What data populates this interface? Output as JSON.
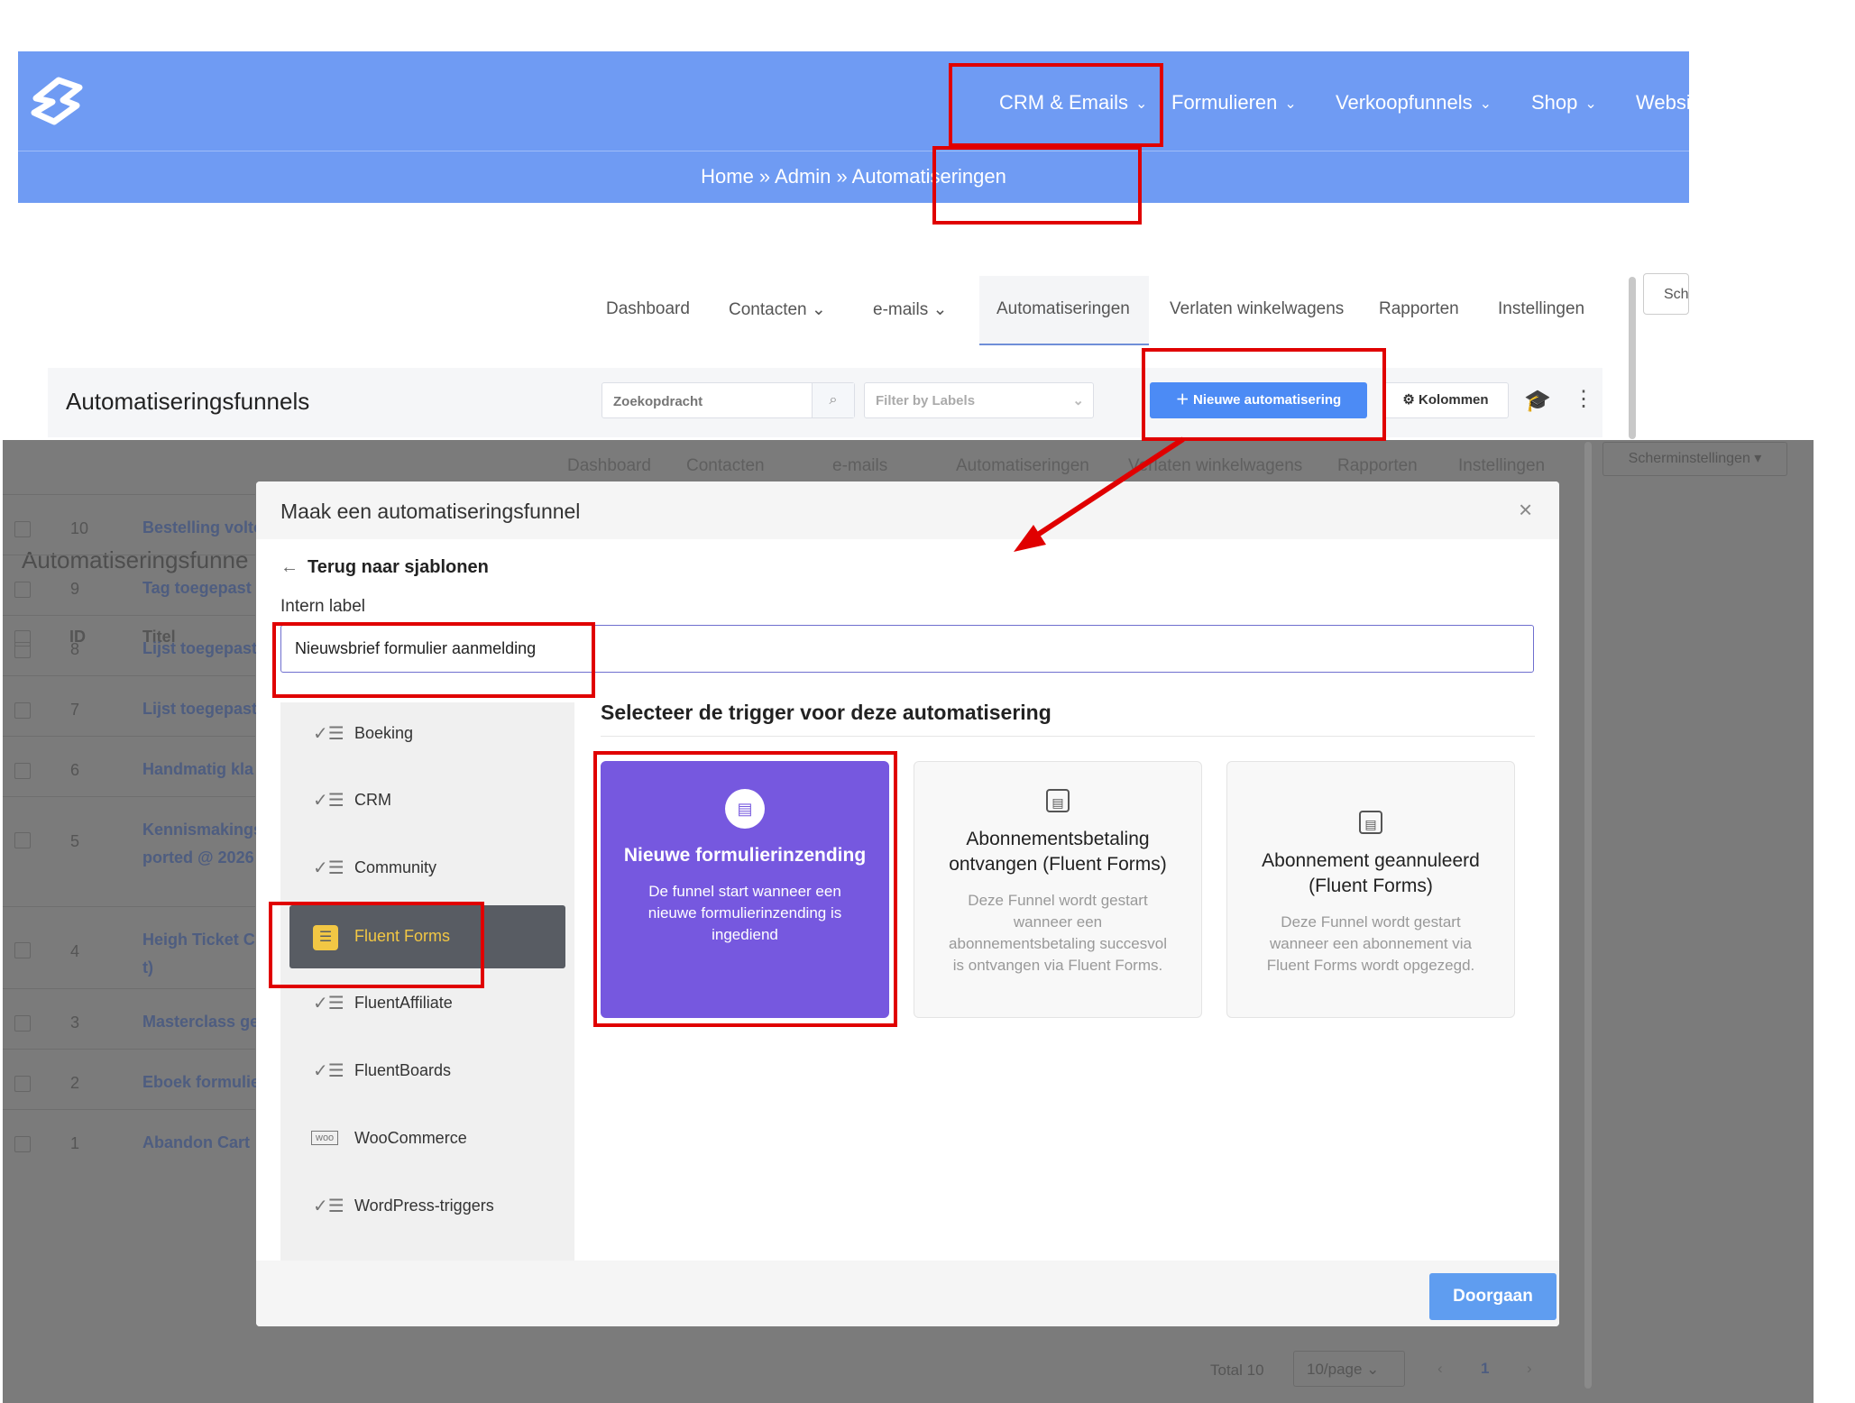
{
  "header": {
    "nav": [
      {
        "label": "CRM & Emails"
      },
      {
        "label": "Formulieren"
      },
      {
        "label": "Verkoopfunnels"
      },
      {
        "label": "Shop"
      },
      {
        "label": "Websi"
      }
    ],
    "breadcrumb": "Home » Admin » Automatiseringen"
  },
  "subnav": {
    "items": [
      "Dashboard",
      "Contacten",
      "e-mails",
      "Automatiseringen",
      "Verlaten winkelwagens",
      "Rapporten",
      "Instellingen"
    ],
    "screen_settings_short": "Sch"
  },
  "toolbar": {
    "title": "Automatiseringsfunnels",
    "search_placeholder": "Zoekopdracht",
    "filter_placeholder": "Filter by Labels",
    "new_button": "Nieuwe automatisering",
    "columns_button": "Kolommen"
  },
  "background": {
    "screen_settings": "Scherminstellingen",
    "title": "Automatiseringsfunne",
    "columns": [
      "ID",
      "Titel"
    ],
    "rows": [
      {
        "id": "10",
        "title": "Bestelling volto"
      },
      {
        "id": "9",
        "title": "Tag toegepast"
      },
      {
        "id": "8",
        "title": "Lijst toegepast"
      },
      {
        "id": "7",
        "title": "Lijst toegepast"
      },
      {
        "id": "6",
        "title": "Handmatig kla"
      },
      {
        "id": "5",
        "title": "Kennismakings",
        "title2": "ported @ 2026"
      },
      {
        "id": "4",
        "title": "Heigh Ticket C",
        "title2": "t)"
      },
      {
        "id": "3",
        "title": "Masterclass ge"
      },
      {
        "id": "2",
        "title": "Eboek formulie"
      },
      {
        "id": "1",
        "title": "Abandon Cart"
      }
    ],
    "pagination": {
      "total": "Total 10",
      "per_page": "10/page",
      "page": "1"
    }
  },
  "modal": {
    "title": "Maak een automatiseringsfunnel",
    "back_link": "Terug naar sjablonen",
    "label_title": "Intern label",
    "label_value": "Nieuwsbrief formulier aanmelding",
    "trigger_title": "Selecteer de trigger voor deze automatisering",
    "categories": [
      "Boeking",
      "CRM",
      "Community",
      "Fluent Forms",
      "FluentAffiliate",
      "FluentBoards",
      "WooCommerce",
      "WordPress-triggers"
    ],
    "woo_icon_text": "woo",
    "cards": [
      {
        "title": "Nieuwe formulierinzending",
        "desc": "De funnel start wanneer een nieuwe formulierinzending is ingediend",
        "selected": true
      },
      {
        "title": "Abonnementsbetaling ontvangen (Fluent Forms)",
        "desc": "Deze Funnel wordt gestart wanneer een abonnementsbetaling succesvol is ontvangen via Fluent Forms.",
        "selected": false
      },
      {
        "title": "Abonnement geannuleerd (Fluent Forms)",
        "desc": "Deze Funnel wordt gestart wanneer een abonnement via Fluent Forms wordt opgezegd.",
        "selected": false
      }
    ],
    "continue_button": "Doorgaan"
  },
  "colors": {
    "header": "#6f9bf3",
    "primary_button": "#4c8bf5",
    "selected_card": "#7658df",
    "annotation": "#e00000",
    "fluent_forms_accent": "#f2c744"
  }
}
